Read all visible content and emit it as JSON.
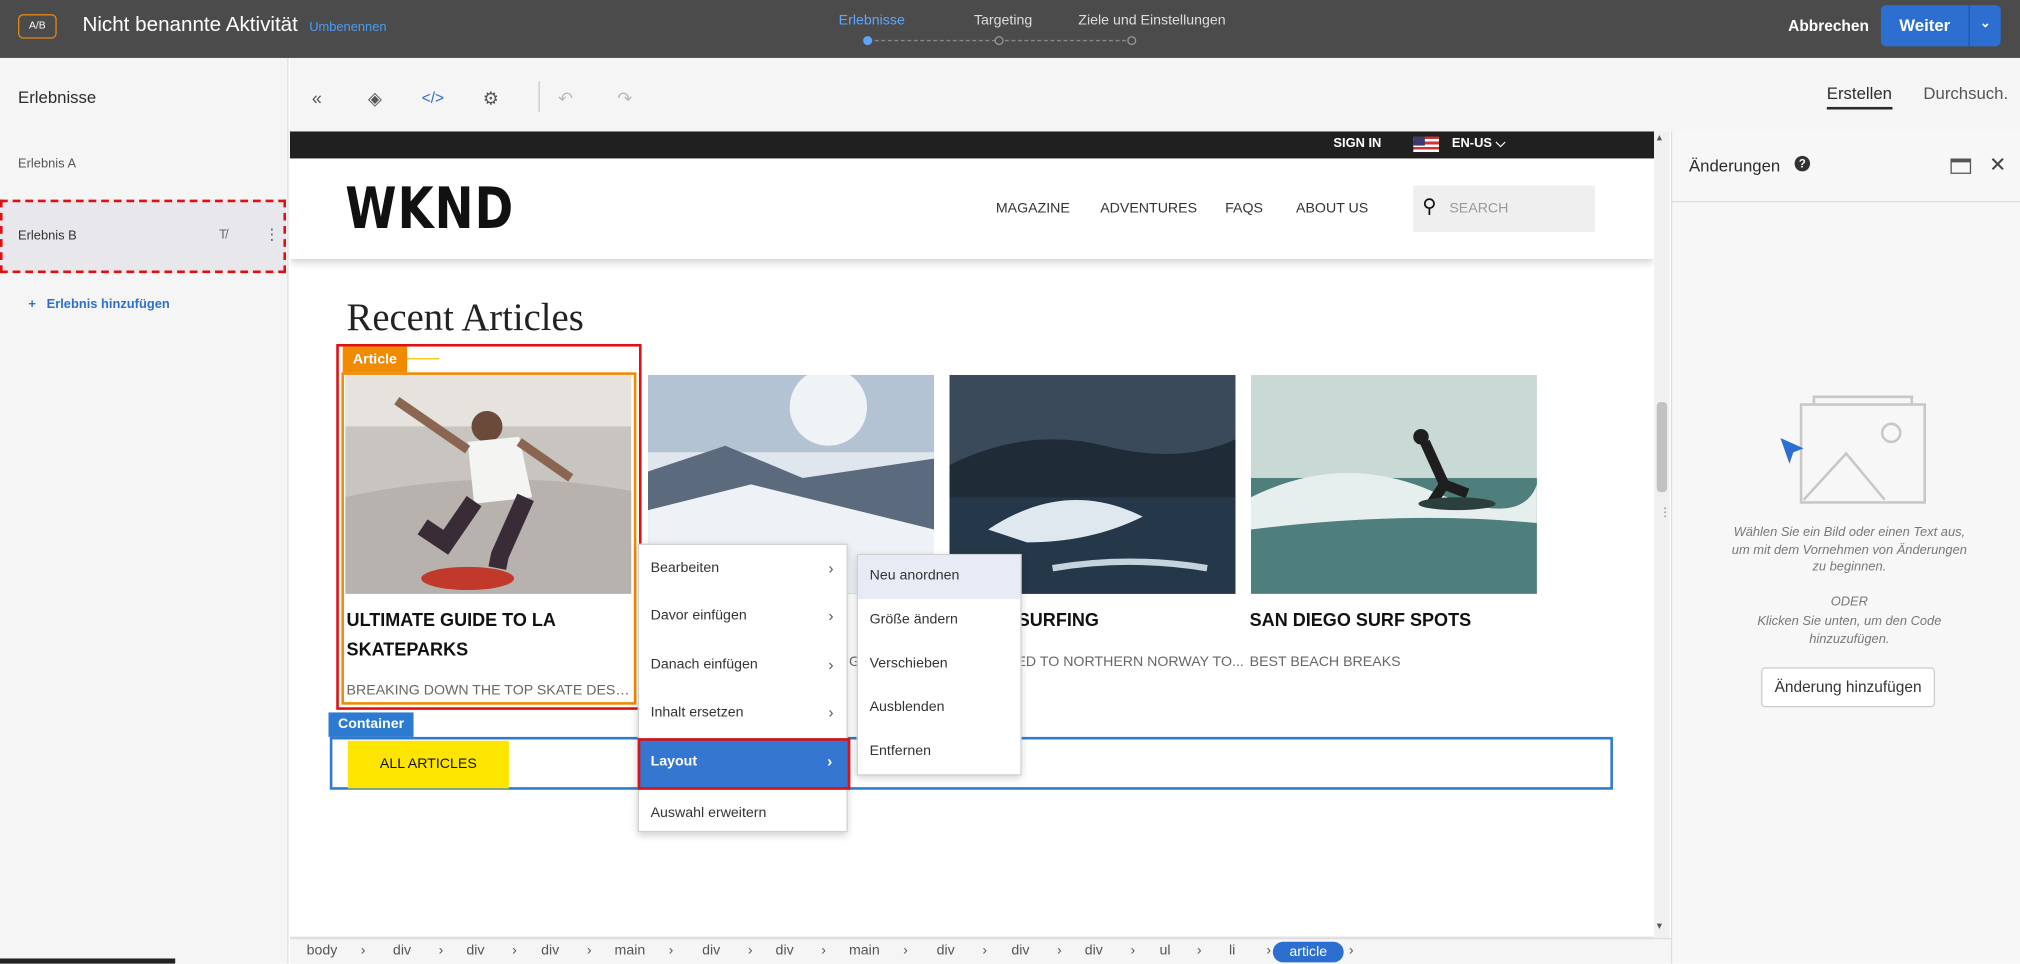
{
  "topbar": {
    "badge": "A/B",
    "activity_title": "Nicht benannte Aktivität",
    "rename": "Umbenennen",
    "steps": [
      "Erlebnisse",
      "Targeting",
      "Ziele und Einstellungen"
    ],
    "cancel": "Abbrechen",
    "next": "Weiter",
    "accent_color": "#2d6fd0"
  },
  "left_panel": {
    "title": "Erlebnisse",
    "experiences": [
      "Erlebnis A",
      "Erlebnis B"
    ],
    "add_experience": "Erlebnis hinzufügen"
  },
  "toolbar": {
    "icons": [
      "collapse-icon",
      "layers-icon",
      "code-icon",
      "settings-icon",
      "undo-icon",
      "redo-icon"
    ],
    "tabs": [
      "Erstellen",
      "Durchsuch."
    ]
  },
  "site": {
    "sign_in": "SIGN IN",
    "lang": "EN-US",
    "logo": "WKND",
    "nav": [
      "MAGAZINE",
      "ADVENTURES",
      "FAQS",
      "ABOUT US"
    ],
    "search_placeholder": "SEARCH",
    "section_title": "Recent Articles",
    "articles": [
      {
        "title": "ULTIMATE GUIDE TO LA SKATEPARKS",
        "subtitle": "BREAKING DOWN THE TOP SKATE DESTIN..."
      },
      {
        "title": "",
        "subtitle": "G"
      },
      {
        "title": "SURFING",
        "subtitle": "ED TO NORTHERN NORWAY TO..."
      },
      {
        "title": "SAN DIEGO SURF SPOTS",
        "subtitle": "BEST BEACH BREAKS"
      }
    ],
    "all_articles": "ALL ARTICLES"
  },
  "selection": {
    "article_tag": "Article",
    "container_tag": "Container"
  },
  "context_menu": {
    "items": [
      "Bearbeiten",
      "Davor einfügen",
      "Danach einfügen",
      "Inhalt ersetzen",
      "Layout",
      "Auswahl erweitern"
    ],
    "submenu": [
      "Neu anordnen",
      "Größe ändern",
      "Verschieben",
      "Ausblenden",
      "Entfernen"
    ]
  },
  "right_panel": {
    "title": "Änderungen",
    "hint": "Wählen Sie ein Bild oder einen Text aus, um mit dem Vornehmen von Änderungen zu beginnen.",
    "or": "ODER",
    "hint2": "Klicken Sie unten, um den Code hinzuzufügen.",
    "add_change": "Änderung hinzufügen"
  },
  "breadcrumb": [
    "body",
    "div",
    "div",
    "div",
    "main",
    "div",
    "div",
    "main",
    "div",
    "div",
    "div",
    "ul",
    "li",
    "article"
  ]
}
